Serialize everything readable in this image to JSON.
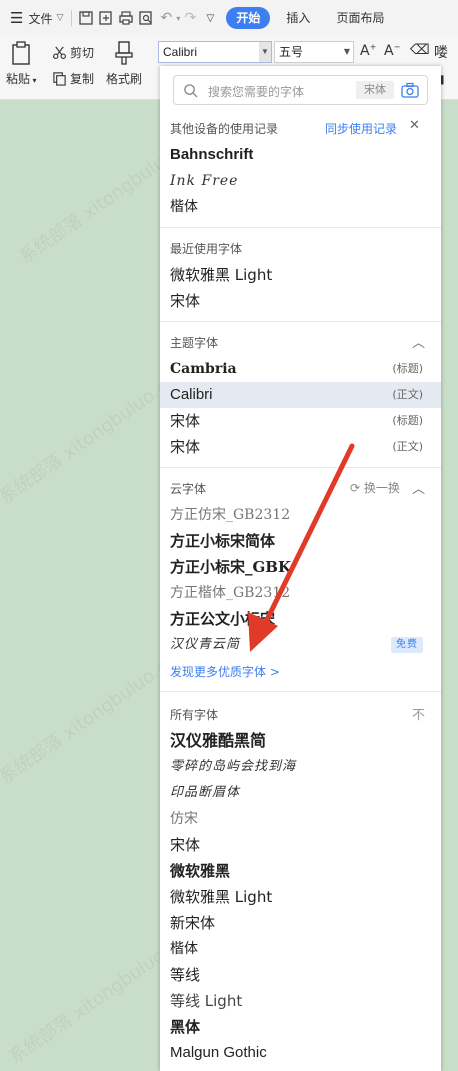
{
  "menubar": {
    "file_label": "文件",
    "tabs": [
      {
        "label": "开始",
        "active": true
      },
      {
        "label": "插入",
        "active": false
      },
      {
        "label": "页面布局",
        "active": false
      }
    ]
  },
  "toolbar": {
    "paste_label": "粘贴",
    "cut_label": "剪切",
    "copy_label": "复制",
    "format_painter_label": "格式刷",
    "font_name": "Calibri",
    "font_size": "五号",
    "phonetic_label": "喽"
  },
  "panel": {
    "search_placeholder": "搜索您需要的字体",
    "search_tag": "宋体",
    "other_devices": {
      "title": "其他设备的使用记录",
      "sync_label": "同步使用记录",
      "items": [
        "Bahnschrift",
        "Ink Free",
        "楷体"
      ]
    },
    "recent": {
      "title": "最近使用字体",
      "items": [
        "微软雅黑 Light",
        "宋体"
      ]
    },
    "theme": {
      "title": "主题字体",
      "items": [
        {
          "name": "Cambria",
          "tag": "(标题)"
        },
        {
          "name": "Calibri",
          "tag": "(正文)"
        },
        {
          "name": "宋体",
          "tag": "(标题)"
        },
        {
          "name": "宋体",
          "tag": "(正文)"
        }
      ]
    },
    "cloud": {
      "title": "云字体",
      "refresh_label": "换一换",
      "items": [
        {
          "name": "方正仿宋_GB2312"
        },
        {
          "name": "方正小标宋简体"
        },
        {
          "name": "方正小标宋_GBK"
        },
        {
          "name": "方正楷体_GB2312"
        },
        {
          "name": "方正公文小标宋"
        },
        {
          "name": "汉仪青云简",
          "badge": "免费"
        }
      ],
      "more_label": "发现更多优质字体 >"
    },
    "all": {
      "title": "所有字体",
      "items": [
        "汉仪雅酷黑简",
        "零碎的岛屿会找到海",
        "印品断眉体",
        "仿宋",
        "宋体",
        "微软雅黑",
        "微软雅黑 Light",
        "新宋体",
        "楷体",
        "等线",
        "等线 Light",
        "黑体",
        "Malgun Gothic"
      ]
    }
  },
  "colors": {
    "accent": "#3d7ef0",
    "doc_background": "#c9dec9",
    "arrow": "#e23a28"
  }
}
